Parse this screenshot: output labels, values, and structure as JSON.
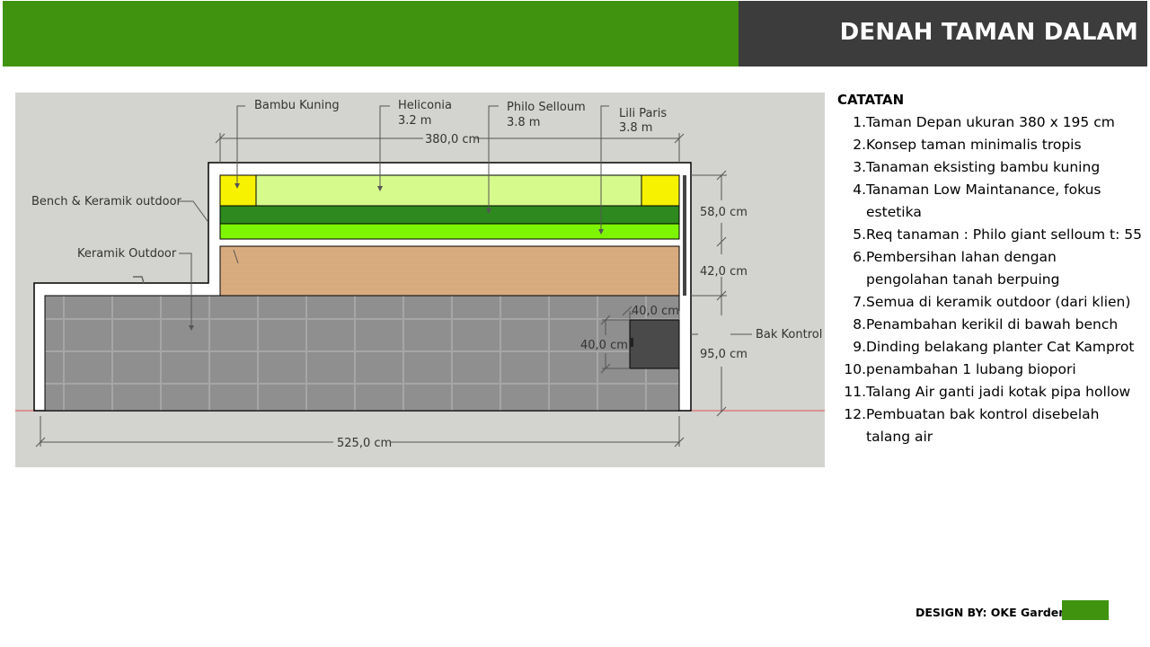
{
  "header": {
    "title": "DENAH TAMAN DALAM",
    "colors": {
      "green": "#3f930f",
      "dark": "#3c3c3c"
    }
  },
  "plan": {
    "labels": {
      "bambu": "Bambu Kuning",
      "heliconia": "Heliconia",
      "heliconia_height": "3.2 m",
      "philo": "Philo Selloum",
      "philo_height": "3.8 m",
      "lili": "Lili Paris",
      "lili_height": "3.8 m",
      "bench": "Bench & Keramik outdoor",
      "keramik": "Keramik Outdoor",
      "bak": "Bak Kontrol"
    },
    "dimensions": {
      "top_width": "380,0 cm",
      "bottom_width": "525,0 cm",
      "right_top": "58,0 cm",
      "right_mid": "42,0 cm",
      "right_bottom": "95,0 cm",
      "box_width": "40,0 cm",
      "box_height": "40,0 cm"
    },
    "colors": {
      "background": "#d3d3cf",
      "yellow": "#f7f200",
      "light_green": "#d6fa8c",
      "dark_green": "#2e8a1e",
      "bright_green": "#7ef500",
      "wood": "#d9ac80",
      "tile": "#8f8f8f",
      "box": "#4a4a4a"
    }
  },
  "notes": {
    "title": "CATATAN",
    "items": [
      {
        "num": "1.",
        "text": "Taman Depan ukuran 380 x 195 cm"
      },
      {
        "num": "2.",
        "text": "Konsep taman minimalis tropis"
      },
      {
        "num": "3.",
        "text": "Tanaman eksisting bambu kuning"
      },
      {
        "num": "4.",
        "text": "Tanaman Low Maintanance, fokus estetika"
      },
      {
        "num": "5.",
        "text": "Req tanaman : Philo giant selloum t: 55"
      },
      {
        "num": "6.",
        "text": "Pembersihan lahan dengan pengolahan tanah berpuing"
      },
      {
        "num": "7.",
        "text": "Semua di keramik outdoor (dari klien)"
      },
      {
        "num": "8.",
        "text": "Penambahan kerikil di bawah bench"
      },
      {
        "num": "9.",
        "text": "Dinding belakang planter Cat Kamprot"
      },
      {
        "num": "10.",
        "text": "penambahan 1 lubang biopori"
      },
      {
        "num": "11.",
        "text": "Talang Air ganti jadi kotak pipa hollow"
      },
      {
        "num": "12.",
        "text": "Pembuatan bak kontrol disebelah talang air"
      }
    ]
  },
  "footer": {
    "credit": "DESIGN BY: OKE Garden"
  }
}
